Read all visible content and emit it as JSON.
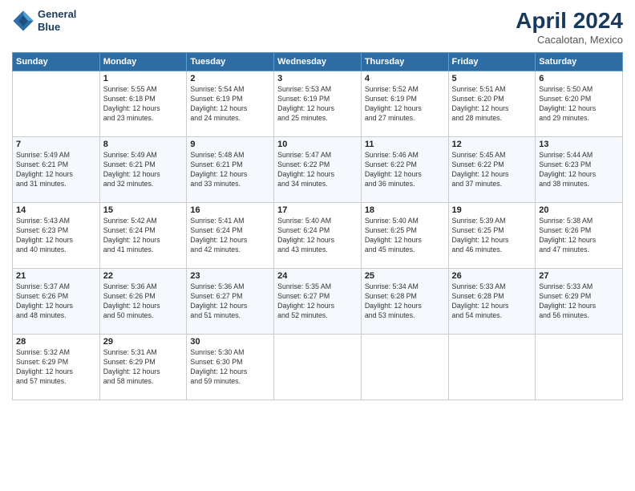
{
  "header": {
    "logo_line1": "General",
    "logo_line2": "Blue",
    "month": "April 2024",
    "location": "Cacalotan, Mexico"
  },
  "days_of_week": [
    "Sunday",
    "Monday",
    "Tuesday",
    "Wednesday",
    "Thursday",
    "Friday",
    "Saturday"
  ],
  "weeks": [
    [
      {
        "day": "",
        "info": ""
      },
      {
        "day": "1",
        "info": "Sunrise: 5:55 AM\nSunset: 6:18 PM\nDaylight: 12 hours\nand 23 minutes."
      },
      {
        "day": "2",
        "info": "Sunrise: 5:54 AM\nSunset: 6:19 PM\nDaylight: 12 hours\nand 24 minutes."
      },
      {
        "day": "3",
        "info": "Sunrise: 5:53 AM\nSunset: 6:19 PM\nDaylight: 12 hours\nand 25 minutes."
      },
      {
        "day": "4",
        "info": "Sunrise: 5:52 AM\nSunset: 6:19 PM\nDaylight: 12 hours\nand 27 minutes."
      },
      {
        "day": "5",
        "info": "Sunrise: 5:51 AM\nSunset: 6:20 PM\nDaylight: 12 hours\nand 28 minutes."
      },
      {
        "day": "6",
        "info": "Sunrise: 5:50 AM\nSunset: 6:20 PM\nDaylight: 12 hours\nand 29 minutes."
      }
    ],
    [
      {
        "day": "7",
        "info": "Sunrise: 5:49 AM\nSunset: 6:21 PM\nDaylight: 12 hours\nand 31 minutes."
      },
      {
        "day": "8",
        "info": "Sunrise: 5:49 AM\nSunset: 6:21 PM\nDaylight: 12 hours\nand 32 minutes."
      },
      {
        "day": "9",
        "info": "Sunrise: 5:48 AM\nSunset: 6:21 PM\nDaylight: 12 hours\nand 33 minutes."
      },
      {
        "day": "10",
        "info": "Sunrise: 5:47 AM\nSunset: 6:22 PM\nDaylight: 12 hours\nand 34 minutes."
      },
      {
        "day": "11",
        "info": "Sunrise: 5:46 AM\nSunset: 6:22 PM\nDaylight: 12 hours\nand 36 minutes."
      },
      {
        "day": "12",
        "info": "Sunrise: 5:45 AM\nSunset: 6:22 PM\nDaylight: 12 hours\nand 37 minutes."
      },
      {
        "day": "13",
        "info": "Sunrise: 5:44 AM\nSunset: 6:23 PM\nDaylight: 12 hours\nand 38 minutes."
      }
    ],
    [
      {
        "day": "14",
        "info": "Sunrise: 5:43 AM\nSunset: 6:23 PM\nDaylight: 12 hours\nand 40 minutes."
      },
      {
        "day": "15",
        "info": "Sunrise: 5:42 AM\nSunset: 6:24 PM\nDaylight: 12 hours\nand 41 minutes."
      },
      {
        "day": "16",
        "info": "Sunrise: 5:41 AM\nSunset: 6:24 PM\nDaylight: 12 hours\nand 42 minutes."
      },
      {
        "day": "17",
        "info": "Sunrise: 5:40 AM\nSunset: 6:24 PM\nDaylight: 12 hours\nand 43 minutes."
      },
      {
        "day": "18",
        "info": "Sunrise: 5:40 AM\nSunset: 6:25 PM\nDaylight: 12 hours\nand 45 minutes."
      },
      {
        "day": "19",
        "info": "Sunrise: 5:39 AM\nSunset: 6:25 PM\nDaylight: 12 hours\nand 46 minutes."
      },
      {
        "day": "20",
        "info": "Sunrise: 5:38 AM\nSunset: 6:26 PM\nDaylight: 12 hours\nand 47 minutes."
      }
    ],
    [
      {
        "day": "21",
        "info": "Sunrise: 5:37 AM\nSunset: 6:26 PM\nDaylight: 12 hours\nand 48 minutes."
      },
      {
        "day": "22",
        "info": "Sunrise: 5:36 AM\nSunset: 6:26 PM\nDaylight: 12 hours\nand 50 minutes."
      },
      {
        "day": "23",
        "info": "Sunrise: 5:36 AM\nSunset: 6:27 PM\nDaylight: 12 hours\nand 51 minutes."
      },
      {
        "day": "24",
        "info": "Sunrise: 5:35 AM\nSunset: 6:27 PM\nDaylight: 12 hours\nand 52 minutes."
      },
      {
        "day": "25",
        "info": "Sunrise: 5:34 AM\nSunset: 6:28 PM\nDaylight: 12 hours\nand 53 minutes."
      },
      {
        "day": "26",
        "info": "Sunrise: 5:33 AM\nSunset: 6:28 PM\nDaylight: 12 hours\nand 54 minutes."
      },
      {
        "day": "27",
        "info": "Sunrise: 5:33 AM\nSunset: 6:29 PM\nDaylight: 12 hours\nand 56 minutes."
      }
    ],
    [
      {
        "day": "28",
        "info": "Sunrise: 5:32 AM\nSunset: 6:29 PM\nDaylight: 12 hours\nand 57 minutes."
      },
      {
        "day": "29",
        "info": "Sunrise: 5:31 AM\nSunset: 6:29 PM\nDaylight: 12 hours\nand 58 minutes."
      },
      {
        "day": "30",
        "info": "Sunrise: 5:30 AM\nSunset: 6:30 PM\nDaylight: 12 hours\nand 59 minutes."
      },
      {
        "day": "",
        "info": ""
      },
      {
        "day": "",
        "info": ""
      },
      {
        "day": "",
        "info": ""
      },
      {
        "day": "",
        "info": ""
      }
    ]
  ]
}
